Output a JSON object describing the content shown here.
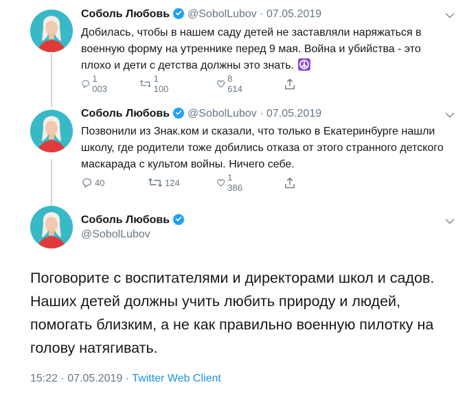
{
  "author": {
    "name": "Соболь Любовь",
    "handle": "@SobolLubov"
  },
  "thread": [
    {
      "date": "07.05.2019",
      "text": "Добилась, чтобы в нашем саду детей не заставляли наряжаться в военную форму на утреннике перед 9 мая. Война и убийства - это плохо и дети с детства должны это знать.",
      "emoji": "peace-symbol-icon",
      "replies": "1 003",
      "retweets": "1 100",
      "likes": "8 614"
    },
    {
      "date": "07.05.2019",
      "text": "Позвонили из Знак.ком и сказали, что только в Екатеринбурге нашли школу, где родители тоже добились отказа от этого странного детского маскарада с культом войны. Ничего себе.",
      "replies": "40",
      "retweets": "124",
      "likes": "1 386"
    }
  ],
  "main_tweet": {
    "text": "Поговорите с воспитателями и директорами школ и садов. Наших детей должны учить любить природу и людей, помогать близким, а не как правильно военную пилотку на голову натягивать.",
    "time": "15:22",
    "date": "07.05.2019",
    "separator": "·",
    "client": "Twitter Web Client"
  },
  "colors": {
    "text": "#14171a",
    "secondary": "#657786",
    "link": "#1b95e0",
    "verified": "#1da1f2",
    "thread_line": "#ccd6dd"
  }
}
